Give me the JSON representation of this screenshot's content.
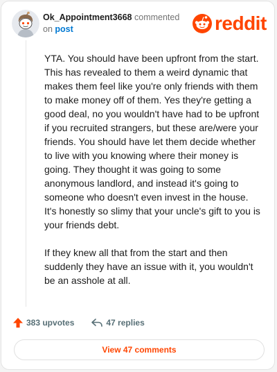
{
  "comment": {
    "username": "Ok_Appointment3668",
    "action_text": "commented",
    "on_text": "on",
    "link_text": "post",
    "paragraphs": [
      "YTA. You should have been upfront from the start. This has revealed to them a weird dynamic that makes them feel like you're only friends with them to make money off of them. Yes they're getting a good deal, no you wouldn't have had to be upfront if you recruited strangers, but these are/were your friends. You should have let them decide whether to live with you knowing where their money is going. They thought it was going to some anonymous landlord, and instead it's going to someone who doesn't even invest in the house. It's honestly so slimy that your uncle's gift to you is your friends debt.",
      "If they knew all that from the start and then suddenly they have an issue with it, you wouldn't be an asshole at all."
    ],
    "upvotes_label": "383 upvotes",
    "replies_label": "47 replies",
    "view_comments_label": "View 47 comments"
  },
  "brand": {
    "logo_text": "reddit",
    "accent_color": "#ff4500",
    "link_color": "#0079d3"
  },
  "icons": {
    "avatar": "snoo-avatar-icon",
    "logo": "reddit-logo-icon",
    "upvote": "upvote-arrow-icon",
    "reply": "reply-arrow-icon"
  }
}
